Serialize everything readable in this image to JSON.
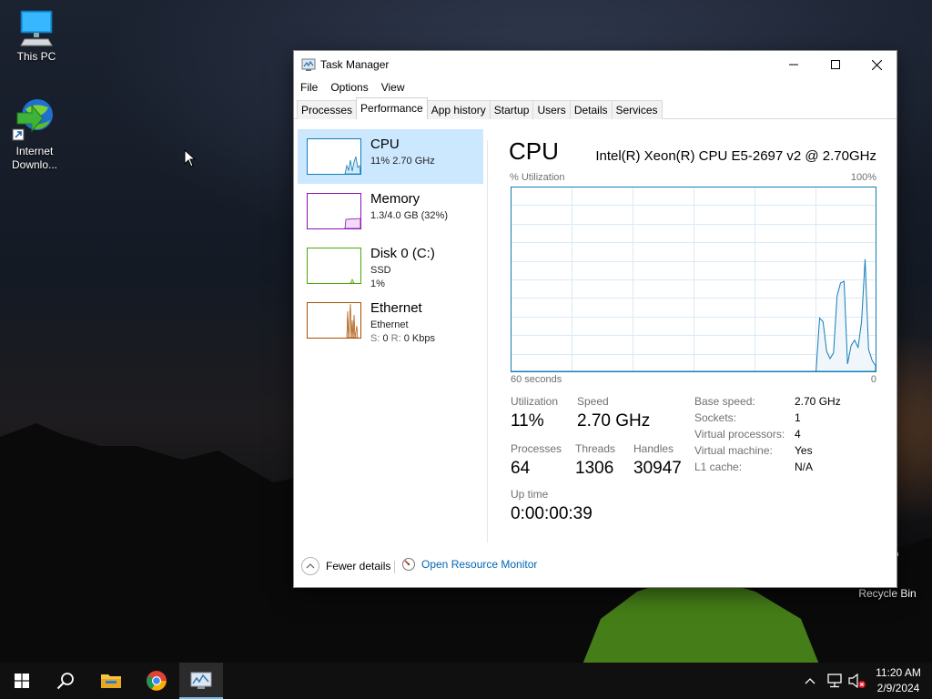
{
  "desktop": {
    "icons": [
      {
        "label": "This PC"
      },
      {
        "label": "Internet Downlo..."
      },
      {
        "label": "Recycle Bin"
      }
    ]
  },
  "window": {
    "title": "Task Manager",
    "menu": [
      "File",
      "Options",
      "View"
    ],
    "tabs": [
      "Processes",
      "Performance",
      "App history",
      "Startup",
      "Users",
      "Details",
      "Services"
    ],
    "active_tab": "Performance"
  },
  "sidebar": {
    "items": [
      {
        "name": "CPU",
        "line1": "11%  2.70 GHz",
        "color": "#117dbb"
      },
      {
        "name": "Memory",
        "line1": "1.3/4.0 GB (32%)",
        "color": "#8b12ae"
      },
      {
        "name": "Disk 0 (C:)",
        "line1": "SSD",
        "line2": "1%",
        "color": "#4da60c"
      },
      {
        "name": "Ethernet",
        "line1": "Ethernet",
        "s_label": "S:",
        "s_value": "0",
        "r_label": "R:",
        "r_value": "0 Kbps",
        "color": "#a74f01"
      }
    ]
  },
  "cpu": {
    "title": "CPU",
    "model": "Intel(R) Xeon(R) CPU E5-2697 v2 @ 2.70GHz",
    "util_label": "% Utilization",
    "util_max": "100%",
    "x_left": "60 seconds",
    "x_right": "0",
    "history_percent": [
      0,
      0,
      0,
      0,
      0,
      0,
      0,
      0,
      0,
      0,
      0,
      0,
      0,
      0,
      0,
      0,
      0,
      0,
      0,
      0,
      0,
      0,
      0,
      0,
      0,
      0,
      0,
      0,
      0,
      0,
      0,
      0,
      0,
      0,
      0,
      0,
      0,
      0,
      0,
      0,
      0,
      0,
      0,
      0,
      0,
      0,
      0,
      0,
      0,
      0,
      0,
      0,
      0,
      0,
      0,
      0,
      0,
      0,
      0,
      0,
      0,
      0,
      0,
      0,
      0,
      0,
      0,
      0,
      0,
      0,
      0,
      0,
      0,
      0,
      0,
      0,
      0,
      0,
      0,
      0,
      0,
      0,
      0,
      0,
      0,
      0,
      0,
      0,
      29,
      27,
      11,
      7,
      10,
      41,
      48,
      49,
      4,
      14,
      17,
      13,
      27,
      61,
      12,
      6,
      3
    ],
    "stats": {
      "utilization": {
        "label": "Utilization",
        "value": "11%"
      },
      "speed": {
        "label": "Speed",
        "value": "2.70 GHz"
      },
      "processes": {
        "label": "Processes",
        "value": "64"
      },
      "threads": {
        "label": "Threads",
        "value": "1306"
      },
      "handles": {
        "label": "Handles",
        "value": "30947"
      },
      "uptime": {
        "label": "Up time",
        "value": "0:00:00:39"
      }
    },
    "props": [
      {
        "k": "Base speed:",
        "v": "2.70 GHz"
      },
      {
        "k": "Sockets:",
        "v": "1"
      },
      {
        "k": "Virtual processors:",
        "v": "4"
      },
      {
        "k": "Virtual machine:",
        "v": "Yes"
      },
      {
        "k": "L1 cache:",
        "v": "N/A"
      }
    ]
  },
  "footer": {
    "fewer_details": "Fewer details",
    "open_resource_monitor": "Open Resource Monitor"
  },
  "taskbar": {
    "time": "11:20 AM",
    "date": "2/9/2024"
  },
  "colors": {
    "cpu_accent": "#117dbb",
    "selection": "#cce8ff",
    "link": "#0066b4"
  }
}
